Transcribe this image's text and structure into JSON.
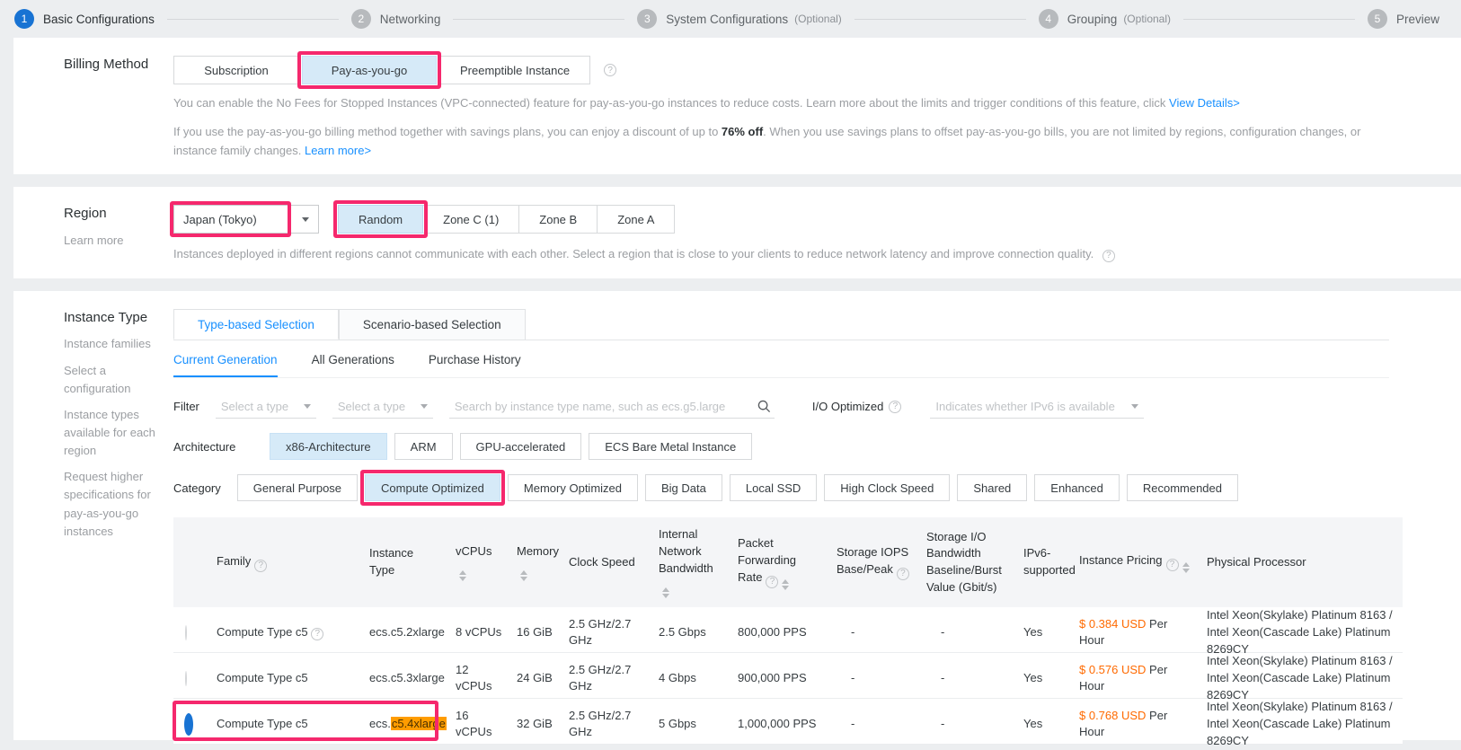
{
  "colors": {
    "accent_blue": "#1873d3",
    "link_blue": "#1890ff",
    "selected_option_bg": "#d6eaf8",
    "annotation_pink": "#f5286d",
    "price_orange": "#ff6a00",
    "search_highlight_orange": "#ff9c00"
  },
  "stepper": {
    "steps": [
      {
        "num": "1",
        "label": "Basic Configurations",
        "optional": ""
      },
      {
        "num": "2",
        "label": "Networking",
        "optional": ""
      },
      {
        "num": "3",
        "label": "System Configurations",
        "optional": "(Optional)"
      },
      {
        "num": "4",
        "label": "Grouping",
        "optional": "(Optional)"
      },
      {
        "num": "5",
        "label": "Preview",
        "optional": ""
      }
    ]
  },
  "billing": {
    "label": "Billing Method",
    "options": [
      "Subscription",
      "Pay-as-you-go",
      "Preemptible Instance"
    ],
    "selected": "Pay-as-you-go",
    "note1": "You can enable the No Fees for Stopped Instances (VPC-connected) feature for pay-as-you-go instances to reduce costs. Learn more about the limits and trigger conditions of this feature, click ",
    "note1_link": "View Details>",
    "note2_pre": "If you use the pay-as-you-go billing method together with savings plans, you can enjoy a discount of up to ",
    "note2_bold": "76% off",
    "note2_post": ". When you use savings plans to offset pay-as-you-go bills, you are not limited by regions, configuration changes, or instance family changes. ",
    "note2_link": "Learn more>"
  },
  "region": {
    "label": "Region",
    "learn_more": "Learn more",
    "selected_region": "Japan (Tokyo)",
    "zones": [
      "Random",
      "Zone C (1)",
      "Zone B",
      "Zone A"
    ],
    "selected_zone": "Random",
    "note": "Instances deployed in different regions cannot communicate with each other. Select a region that is close to your clients to reduce network latency and improve connection quality."
  },
  "instance": {
    "label": "Instance Type",
    "side_links": [
      "Instance families",
      "Select a configuration",
      "Instance types available for each region",
      "Request higher specifications for pay-as-you-go instances"
    ],
    "tabs": [
      "Type-based Selection",
      "Scenario-based Selection"
    ],
    "active_tab": "Type-based Selection",
    "subtabs": [
      "Current Generation",
      "All Generations",
      "Purchase History"
    ],
    "active_subtab": "Current Generation",
    "filter": {
      "label": "Filter",
      "type_placeholder_1": "Select a type",
      "type_placeholder_2": "Select a type",
      "search_placeholder": "Search by instance type name, such as ecs.g5.large",
      "io_optimized_label": "I/O Optimized",
      "ipv6_placeholder": "Indicates whether IPv6 is available"
    },
    "architecture": {
      "label": "Architecture",
      "options": [
        "x86-Architecture",
        "ARM",
        "GPU-accelerated",
        "ECS Bare Metal Instance"
      ],
      "selected": "x86-Architecture"
    },
    "category": {
      "label": "Category",
      "options": [
        "General Purpose",
        "Compute Optimized",
        "Memory Optimized",
        "Big Data",
        "Local SSD",
        "High Clock Speed",
        "Shared",
        "Enhanced",
        "Recommended"
      ],
      "selected": "Compute Optimized"
    },
    "table": {
      "headers": {
        "family": "Family",
        "instance_type": "Instance Type",
        "vcpus": "vCPUs",
        "memory": "Memory",
        "clock": "Clock Speed",
        "bandwidth": "Internal Network Bandwidth",
        "pps": "Packet Forwarding Rate",
        "iops": "Storage IOPS Base/Peak",
        "storage_io": "Storage I/O Bandwidth Baseline/Burst Value (Gbit/s)",
        "ipv6": "IPv6-supported",
        "pricing": "Instance Pricing",
        "processor": "Physical Processor"
      },
      "rows": [
        {
          "selected": false,
          "family": "Compute Type c5",
          "type_pre": "ecs.c5.2xlarge",
          "type_hl": "",
          "vcpus": "8 vCPUs",
          "memory": "16 GiB",
          "clock": "2.5 GHz/2.7 GHz",
          "bandwidth": "2.5 Gbps",
          "pps": "800,000 PPS",
          "iops": "-",
          "storage_io": "-",
          "ipv6": "Yes",
          "price": "$ 0.384 USD",
          "price_unit": " Per Hour",
          "processor": "Intel Xeon(Skylake) Platinum 8163 / Intel Xeon(Cascade Lake) Platinum 8269CY"
        },
        {
          "selected": false,
          "family": "Compute Type c5",
          "type_pre": "ecs.c5.3xlarge",
          "type_hl": "",
          "vcpus": "12 vCPUs",
          "memory": "24 GiB",
          "clock": "2.5 GHz/2.7 GHz",
          "bandwidth": "4 Gbps",
          "pps": "900,000 PPS",
          "iops": "-",
          "storage_io": "-",
          "ipv6": "Yes",
          "price": "$ 0.576 USD",
          "price_unit": " Per Hour",
          "processor": "Intel Xeon(Skylake) Platinum 8163 / Intel Xeon(Cascade Lake) Platinum 8269CY"
        },
        {
          "selected": true,
          "family": "Compute Type c5",
          "type_pre": "ecs.",
          "type_hl": "c5.4xlarge",
          "vcpus": "16 vCPUs",
          "memory": "32 GiB",
          "clock": "2.5 GHz/2.7 GHz",
          "bandwidth": "5 Gbps",
          "pps": "1,000,000 PPS",
          "iops": "-",
          "storage_io": "-",
          "ipv6": "Yes",
          "price": "$ 0.768 USD",
          "price_unit": " Per Hour",
          "processor": "Intel Xeon(Skylake) Platinum 8163 / Intel Xeon(Cascade Lake) Platinum 8269CY"
        }
      ]
    }
  }
}
